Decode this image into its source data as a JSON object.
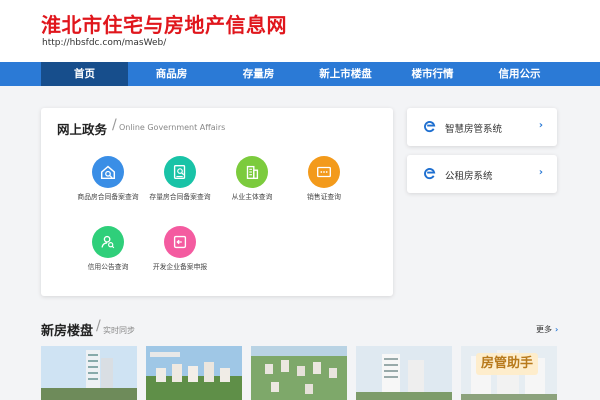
{
  "header": {
    "site_title": "淮北市住宅与房地产信息网",
    "site_url": "http://hbsfdc.com/masWeb/"
  },
  "nav": {
    "items": [
      {
        "label": "首页"
      },
      {
        "label": "商品房"
      },
      {
        "label": "存量房"
      },
      {
        "label": "新上市楼盘"
      },
      {
        "label": "楼市行情"
      },
      {
        "label": "信用公示"
      }
    ],
    "active_index": 0
  },
  "gov": {
    "title": "网上政务",
    "subtitle": "Online Government Affairs",
    "services": [
      {
        "label": "商品房合同备案查询",
        "icon": "house-search-icon",
        "color": "#3a8ee6"
      },
      {
        "label": "存量房合同备案查询",
        "icon": "document-search-icon",
        "color": "#19c3a7"
      },
      {
        "label": "从业主体查询",
        "icon": "building-icon",
        "color": "#7ccb3d"
      },
      {
        "label": "销售证查询",
        "icon": "certificate-icon",
        "color": "#f39a1b"
      },
      {
        "label": "信用公告查询",
        "icon": "person-search-icon",
        "color": "#2fcf7a"
      },
      {
        "label": "开发企业备案申报",
        "icon": "login-icon",
        "color": "#f45ba0"
      }
    ]
  },
  "side_links": [
    {
      "label": "智慧房管系统",
      "icon": "e-logo-icon"
    },
    {
      "label": "公租房系统",
      "icon": "e-logo-icon"
    }
  ],
  "new_houses": {
    "title": "新房楼盘",
    "subtitle": "实时同步",
    "more_label": "更多"
  },
  "watermark": "房管助手",
  "colors": {
    "brand_red": "#e0161c",
    "nav_blue": "#2b7ad6",
    "nav_active": "#174e8c"
  }
}
